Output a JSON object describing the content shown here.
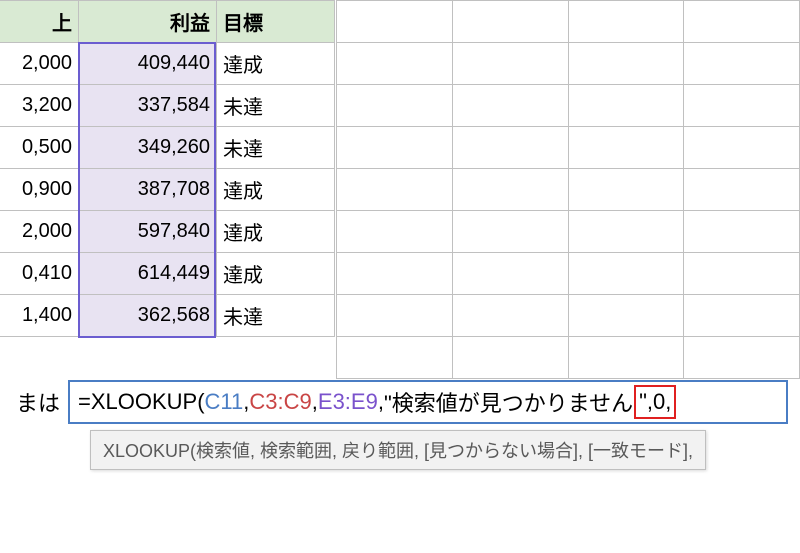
{
  "headers": {
    "colA": "上",
    "colB": "利益",
    "colC": "目標"
  },
  "rows": [
    {
      "a": "2,000",
      "b": "409,440",
      "c": "達成"
    },
    {
      "a": "3,200",
      "b": "337,584",
      "c": "未達"
    },
    {
      "a": "0,500",
      "b": "349,260",
      "c": "未達"
    },
    {
      "a": "0,900",
      "b": "387,708",
      "c": "達成"
    },
    {
      "a": "2,000",
      "b": "597,840",
      "c": "達成"
    },
    {
      "a": "0,410",
      "b": "614,449",
      "c": "達成"
    },
    {
      "a": "1,400",
      "b": "362,568",
      "c": "未達"
    }
  ],
  "formula": {
    "label": "まは",
    "prefix": "=XLOOKUP(",
    "arg1": "C11",
    "sep": ",",
    "arg2": "C3:C9",
    "arg3": "E3:E9",
    "arg4": "\"検索値が見つかりません",
    "redbox": "\",0,"
  },
  "tooltip": "XLOOKUP(検索値, 検索範囲, 戻り範囲, [見つからない場合], [一致モード],",
  "colors": {
    "headerBg": "#d9ead3",
    "selectedBg": "#e8e3f2",
    "selectionBorder": "#6b5dd0",
    "formulaBorder": "#4a7dc4",
    "redHighlight": "#e02020"
  }
}
